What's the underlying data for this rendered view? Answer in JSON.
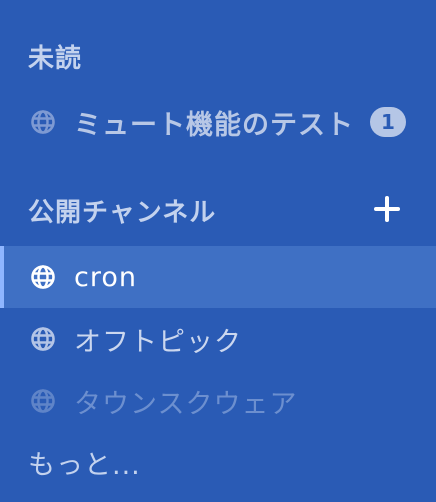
{
  "colors": {
    "background": "#2a5bb5",
    "active_row": "#3f70c4",
    "active_accent": "#8fb6ff",
    "badge_bg": "#b5c6e6"
  },
  "unread": {
    "header": "未読",
    "items": [
      {
        "icon": "globe-icon",
        "label": "ミュート機能のテスト",
        "badge": "1",
        "state": "muted"
      }
    ]
  },
  "public_channels": {
    "header": "公開チャンネル",
    "add_icon": "plus-icon",
    "items": [
      {
        "icon": "globe-icon",
        "label": "cron",
        "state": "active"
      },
      {
        "icon": "globe-icon",
        "label": "オフトピック",
        "state": "normal"
      },
      {
        "icon": "globe-icon",
        "label": "タウンスクウェア",
        "state": "faded"
      }
    ],
    "more_label": "もっと..."
  }
}
